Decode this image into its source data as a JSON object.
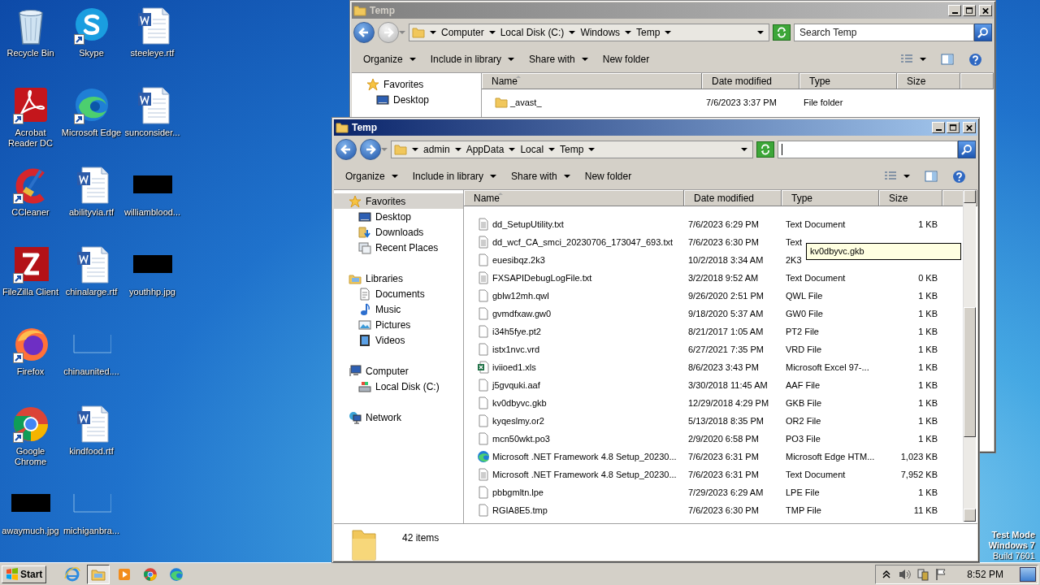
{
  "desktop": {
    "icons": [
      {
        "label": "Recycle Bin",
        "kind": "recycle",
        "shortcut": false
      },
      {
        "label": "Acrobat Reader DC",
        "kind": "acrobat",
        "shortcut": true
      },
      {
        "label": "CCleaner",
        "kind": "ccleaner",
        "shortcut": true
      },
      {
        "label": "FileZilla Client",
        "kind": "filezilla",
        "shortcut": true
      },
      {
        "label": "Firefox",
        "kind": "firefox",
        "shortcut": true
      },
      {
        "label": "Google Chrome",
        "kind": "chrome",
        "shortcut": true
      },
      {
        "label": "awaymuch.jpg",
        "kind": "thumb",
        "shortcut": false
      },
      {
        "label": "Skype",
        "kind": "skype",
        "shortcut": true
      },
      {
        "label": "Microsoft Edge",
        "kind": "edge",
        "shortcut": true
      },
      {
        "label": "abilityvia.rtf",
        "kind": "word",
        "shortcut": false
      },
      {
        "label": "chinalarge.rtf",
        "kind": "word",
        "shortcut": false
      },
      {
        "label": "chinaunited....",
        "kind": "blank",
        "shortcut": false
      },
      {
        "label": "kindfood.rtf",
        "kind": "word",
        "shortcut": false
      },
      {
        "label": "michiganbra...",
        "kind": "blank",
        "shortcut": false
      },
      {
        "label": "steeleye.rtf",
        "kind": "word",
        "shortcut": false
      },
      {
        "label": "sunconsider...",
        "kind": "word",
        "shortcut": false
      },
      {
        "label": "williamblood...",
        "kind": "thumb",
        "shortcut": false
      },
      {
        "label": "youthhp.jpg",
        "kind": "thumb",
        "shortcut": false
      }
    ],
    "notice": [
      "Test Mode",
      "Windows 7",
      "Build 7601"
    ]
  },
  "windows": [
    {
      "title": "Temp",
      "active": false,
      "back_enabled": true,
      "forward_enabled": false,
      "path": [
        "Computer",
        "Local Disk (C:)",
        "Windows",
        "Temp"
      ],
      "search": {
        "placeholder": "Search Temp"
      },
      "toolbar": [
        {
          "label": "Organize",
          "menu": true
        },
        {
          "label": "Include in library",
          "menu": true
        },
        {
          "label": "Share with",
          "menu": true
        },
        {
          "label": "New folder",
          "menu": false
        }
      ],
      "sidebar": [
        {
          "label": "Favorites",
          "kind": "star",
          "selected": false,
          "children": [
            {
              "label": "Desktop",
              "kind": "desktop",
              "selected": false
            }
          ]
        }
      ],
      "columns": [
        {
          "label": "Name",
          "sorted": true
        },
        {
          "label": "Date modified",
          "sorted": false
        },
        {
          "label": "Type",
          "sorted": false
        },
        {
          "label": "Size",
          "sorted": false
        }
      ],
      "rows": [
        {
          "name": "_avast_",
          "date": "7/6/2023 3:37 PM",
          "type": "File folder",
          "kind": "folder"
        }
      ]
    },
    {
      "title": "Temp",
      "active": true,
      "back_enabled": true,
      "forward_enabled": true,
      "path": [
        "admin",
        "AppData",
        "Local",
        "Temp"
      ],
      "search": {
        "focused": true
      },
      "toolbar": [
        {
          "label": "Organize",
          "menu": true
        },
        {
          "label": "Include in library",
          "menu": true
        },
        {
          "label": "Share with",
          "menu": true
        },
        {
          "label": "New folder",
          "menu": false
        }
      ],
      "sidebar": [
        {
          "label": "Favorites",
          "kind": "star",
          "selected": true,
          "children": [
            {
              "label": "Desktop",
              "kind": "desktop",
              "selected": false
            },
            {
              "label": "Downloads",
              "kind": "downloads",
              "selected": false
            },
            {
              "label": "Recent Places",
              "kind": "recent",
              "selected": false
            }
          ]
        },
        {
          "label": "Libraries",
          "kind": "library",
          "selected": false,
          "children": [
            {
              "label": "Documents",
              "kind": "documents",
              "selected": false
            },
            {
              "label": "Music",
              "kind": "music",
              "selected": false
            },
            {
              "label": "Pictures",
              "kind": "pictures",
              "selected": false
            },
            {
              "label": "Videos",
              "kind": "videos",
              "selected": false
            }
          ]
        },
        {
          "label": "Computer",
          "kind": "computer",
          "selected": false,
          "children": [
            {
              "label": "Local Disk (C:)",
              "kind": "disk",
              "selected": false
            }
          ]
        },
        {
          "label": "Network",
          "kind": "network",
          "selected": false
        }
      ],
      "columns": [
        {
          "label": "Name",
          "sorted": true
        },
        {
          "label": "Date modified",
          "sorted": false
        },
        {
          "label": "Type",
          "sorted": false
        },
        {
          "label": "Size",
          "sorted": false
        }
      ],
      "rows": [
        {
          "name": "dd_SetupUtility.txt",
          "date": "7/6/2023 6:29 PM",
          "type": "Text Document",
          "size": "1 KB",
          "kind": "text"
        },
        {
          "name": "dd_wcf_CA_smci_20230706_173047_693.txt",
          "date": "7/6/2023 6:30 PM",
          "type": "Text",
          "kind": "text"
        },
        {
          "name": "euesibqz.2k3",
          "date": "10/2/2018 3:34 AM",
          "type": "2K3",
          "kind": "blank"
        },
        {
          "name": "FXSAPIDebugLogFile.txt",
          "date": "3/2/2018 9:52 AM",
          "type": "Text Document",
          "size": "0 KB",
          "kind": "text"
        },
        {
          "name": "gblw12mh.qwl",
          "date": "9/26/2020 2:51 PM",
          "type": "QWL File",
          "size": "1 KB",
          "kind": "blank"
        },
        {
          "name": "gvmdfxaw.gw0",
          "date": "9/18/2020 5:37 AM",
          "type": "GW0 File",
          "size": "1 KB",
          "kind": "blank"
        },
        {
          "name": "i34h5fye.pt2",
          "date": "8/21/2017 1:05 AM",
          "type": "PT2 File",
          "size": "1 KB",
          "kind": "blank"
        },
        {
          "name": "istx1nvc.vrd",
          "date": "6/27/2021 7:35 PM",
          "type": "VRD File",
          "size": "1 KB",
          "kind": "blank"
        },
        {
          "name": "iviioed1.xls",
          "date": "8/6/2023 3:43 PM",
          "type": "Microsoft Excel 97-...",
          "size": "1 KB",
          "kind": "excel"
        },
        {
          "name": "j5gvquki.aaf",
          "date": "3/30/2018 11:45 AM",
          "type": "AAF File",
          "size": "1 KB",
          "kind": "blank"
        },
        {
          "name": "kv0dbyvc.gkb",
          "date": "12/29/2018 4:29 PM",
          "type": "GKB File",
          "size": "1 KB",
          "kind": "blank"
        },
        {
          "name": "kyqeslmy.or2",
          "date": "5/13/2018 8:35 PM",
          "type": "OR2 File",
          "size": "1 KB",
          "kind": "blank"
        },
        {
          "name": "mcn50wkt.po3",
          "date": "2/9/2020 6:58 PM",
          "type": "PO3 File",
          "size": "1 KB",
          "kind": "blank"
        },
        {
          "name": "Microsoft .NET Framework 4.8 Setup_20230...",
          "date": "7/6/2023 6:31 PM",
          "type": "Microsoft Edge HTM...",
          "size": "1,023 KB",
          "kind": "edge"
        },
        {
          "name": "Microsoft .NET Framework 4.8 Setup_20230...",
          "date": "7/6/2023 6:31 PM",
          "type": "Text Document",
          "size": "7,952 KB",
          "kind": "text"
        },
        {
          "name": "pbbgmltn.lpe",
          "date": "7/29/2023 6:29 AM",
          "type": "LPE File",
          "size": "1 KB",
          "kind": "blank"
        },
        {
          "name": "RGIA8E5.tmp",
          "date": "7/6/2023 6:30 PM",
          "type": "TMP File",
          "size": "11 KB",
          "kind": "blank"
        }
      ],
      "tooltip": "kv0dbyvc.gkb",
      "status": "42 items"
    }
  ],
  "taskbar": {
    "start": "Start",
    "apps": [
      {
        "kind": "ie",
        "active": false
      },
      {
        "kind": "explorer",
        "active": true
      },
      {
        "kind": "media",
        "active": false
      },
      {
        "kind": "chrome",
        "active": false
      },
      {
        "kind": "edge",
        "active": false
      }
    ],
    "clock": "8:52 PM"
  }
}
